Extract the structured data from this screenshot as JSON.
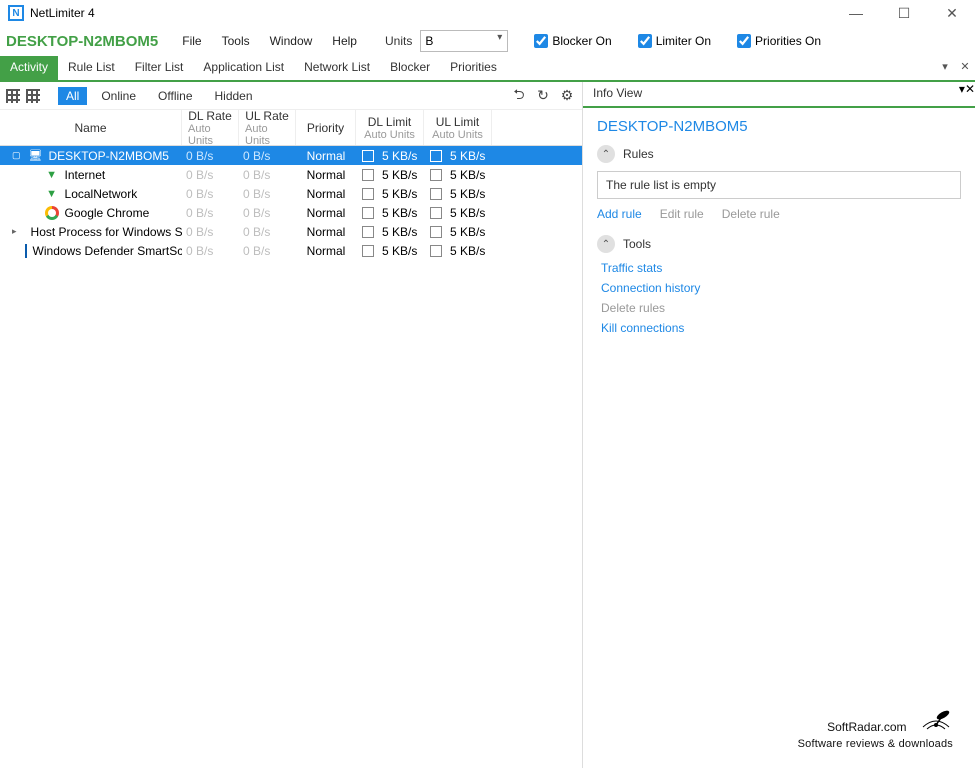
{
  "window": {
    "title": "NetLimiter 4"
  },
  "header": {
    "computer": "DESKTOP-N2MBOM5",
    "menus": [
      "File",
      "Tools",
      "Window",
      "Help"
    ],
    "units_label": "Units",
    "units_value": "B",
    "checks": [
      {
        "label": "Blocker On",
        "checked": true
      },
      {
        "label": "Limiter On",
        "checked": true
      },
      {
        "label": "Priorities On",
        "checked": true
      }
    ]
  },
  "tabs": {
    "items": [
      "Activity",
      "Rule List",
      "Filter List",
      "Application List",
      "Network List",
      "Blocker",
      "Priorities"
    ],
    "active": 0
  },
  "filters": {
    "items": [
      "All",
      "Online",
      "Offline",
      "Hidden"
    ],
    "active": 0
  },
  "columns": {
    "name": "Name",
    "dl_rate": "DL Rate",
    "dl_rate_sub": "Auto Units",
    "ul_rate": "UL Rate",
    "ul_rate_sub": "Auto Units",
    "priority": "Priority",
    "dl_limit": "DL Limit",
    "dl_limit_sub": "Auto Units",
    "ul_limit": "UL Limit",
    "ul_limit_sub": "Auto Units"
  },
  "rows": [
    {
      "icon": "monitor",
      "name": "DESKTOP-N2MBOM5",
      "dl": "0 B/s",
      "ul": "0 B/s",
      "pri": "Normal",
      "dll": "5 KB/s",
      "ull": "5 KB/s",
      "indent": 0,
      "selected": true,
      "expander": "▢"
    },
    {
      "icon": "funnel",
      "name": "Internet",
      "dl": "0 B/s",
      "ul": "0 B/s",
      "pri": "Normal",
      "dll": "5 KB/s",
      "ull": "5 KB/s",
      "indent": 1
    },
    {
      "icon": "funnel",
      "name": "LocalNetwork",
      "dl": "0 B/s",
      "ul": "0 B/s",
      "pri": "Normal",
      "dll": "5 KB/s",
      "ull": "5 KB/s",
      "indent": 1
    },
    {
      "icon": "chrome",
      "name": "Google Chrome",
      "dl": "0 B/s",
      "ul": "0 B/s",
      "pri": "Normal",
      "dll": "5 KB/s",
      "ull": "5 KB/s",
      "indent": 1
    },
    {
      "icon": "win",
      "name": "Host Process for Windows Se",
      "dl": "0 B/s",
      "ul": "0 B/s",
      "pri": "Normal",
      "dll": "5 KB/s",
      "ull": "5 KB/s",
      "indent": 1,
      "expander": "▸"
    },
    {
      "icon": "defender",
      "name": "Windows Defender SmartScr",
      "dl": "0 B/s",
      "ul": "0 B/s",
      "pri": "Normal",
      "dll": "5 KB/s",
      "ull": "5 KB/s",
      "indent": 1
    }
  ],
  "info": {
    "tab": "Info View",
    "title": "DESKTOP-N2MBOM5",
    "rules_header": "Rules",
    "rules_empty": "The rule list is empty",
    "rule_links": [
      {
        "label": "Add rule",
        "active": true
      },
      {
        "label": "Edit rule",
        "active": false
      },
      {
        "label": "Delete rule",
        "active": false
      }
    ],
    "tools_header": "Tools",
    "tool_links": [
      {
        "label": "Traffic stats",
        "active": true
      },
      {
        "label": "Connection history",
        "active": true
      },
      {
        "label": "Delete rules",
        "active": false
      },
      {
        "label": "Kill connections",
        "active": true
      }
    ]
  },
  "watermark": {
    "brand": "SoftRadar.com",
    "sub": "Software reviews & downloads"
  }
}
